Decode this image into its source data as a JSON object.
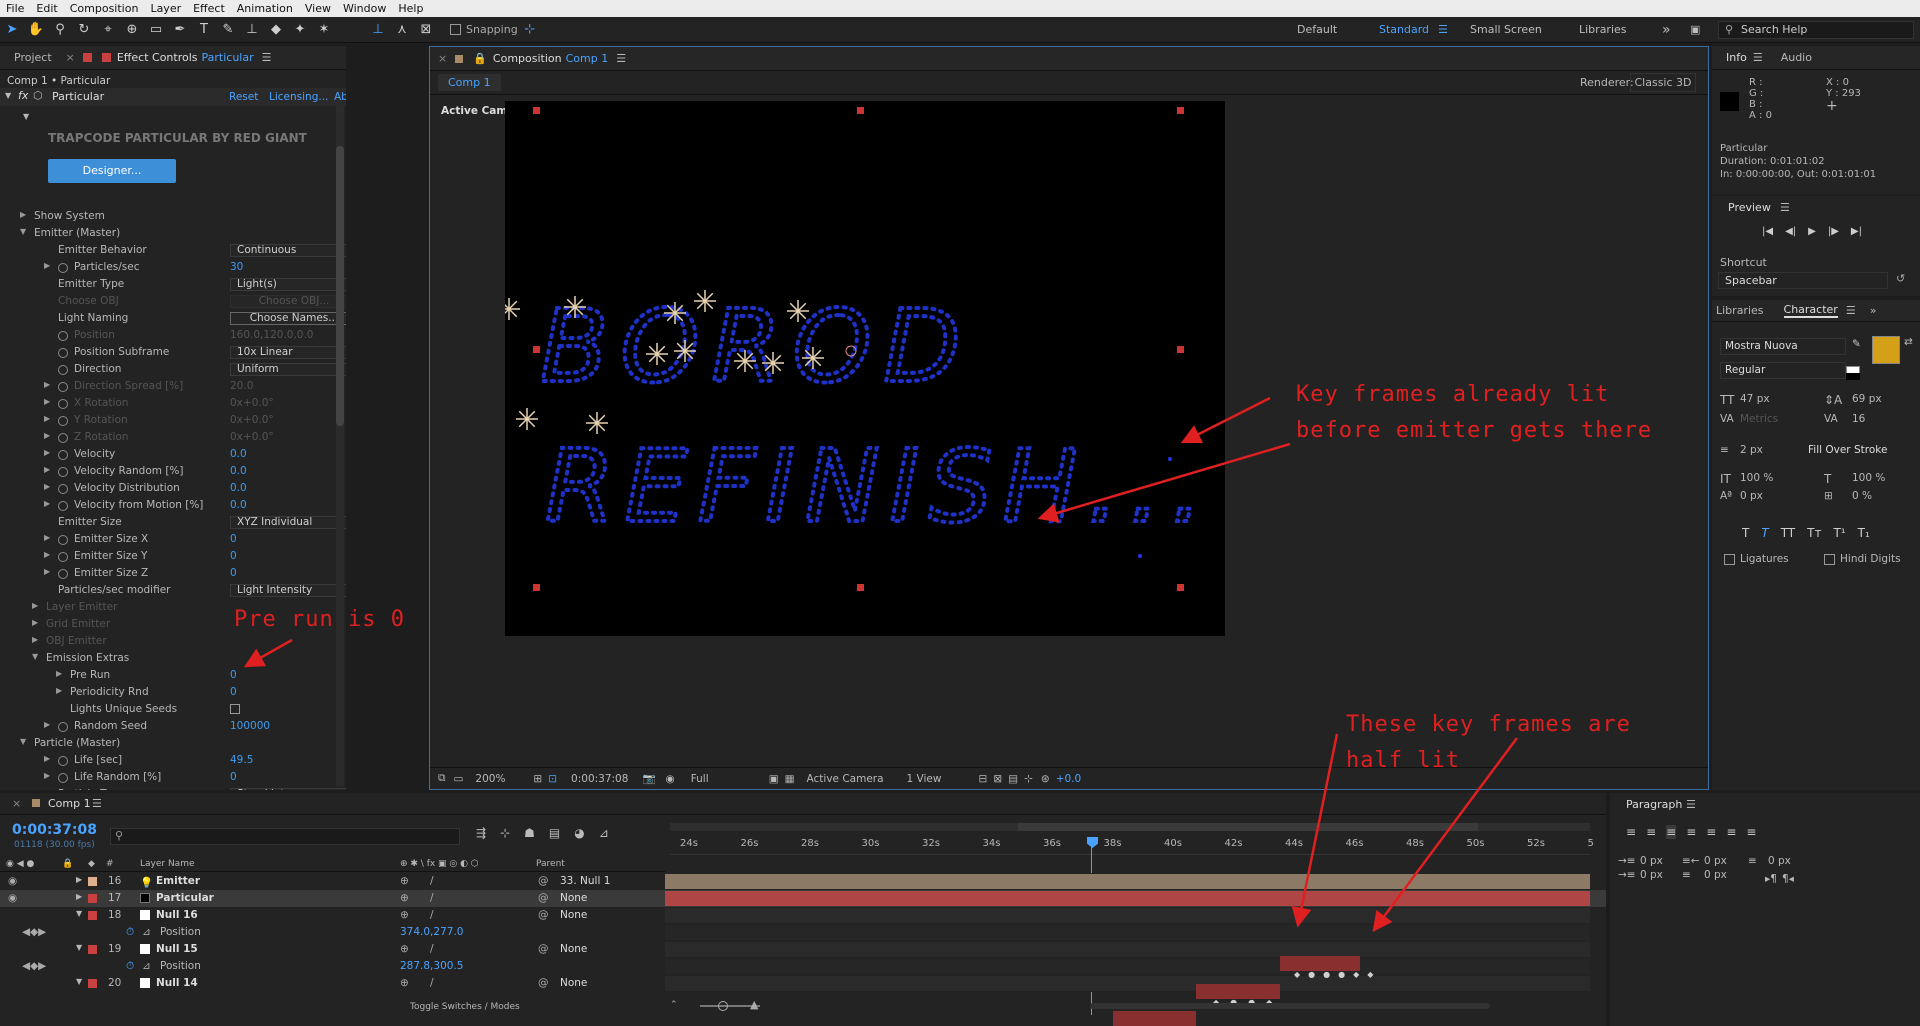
{
  "menu": [
    "File",
    "Edit",
    "Composition",
    "Layer",
    "Effect",
    "Animation",
    "View",
    "Window",
    "Help"
  ],
  "toolbar": {
    "snapping": "Snapping",
    "workspaces": [
      "Default",
      "Standard",
      "Small Screen",
      "Libraries"
    ],
    "active_workspace": "Standard",
    "search_placeholder": "Search Help",
    "more": "»"
  },
  "effect_panel": {
    "tab_project": "Project",
    "tab_effect_controls": "Effect Controls",
    "tab_effect_layer": "Particular",
    "breadcrumb": "Comp 1 • Particular",
    "effect_name": "Particular",
    "fx": "fx",
    "reset": "Reset",
    "licensing": "Licensing...",
    "about": "About...",
    "brand": "TRAPCODE PARTICULAR BY RED GIANT",
    "designer_button": "Designer...",
    "rows": [
      {
        "label": "Show System",
        "indent": 0,
        "tri": "right"
      },
      {
        "label": "Emitter (Master)",
        "indent": 0,
        "tri": "down"
      },
      {
        "label": "Emitter Behavior",
        "indent": 2,
        "dd": "Continuous"
      },
      {
        "label": "Particles/sec",
        "indent": 2,
        "tri": "right",
        "sw": true,
        "value": "30"
      },
      {
        "label": "Emitter Type",
        "indent": 2,
        "dd": "Light(s)"
      },
      {
        "label": "Choose OBJ",
        "indent": 2,
        "dim": true,
        "button": "Choose OBJ..."
      },
      {
        "label": "Light Naming",
        "indent": 2,
        "button": "Choose Names..."
      },
      {
        "label": "Position",
        "indent": 2,
        "sw": true,
        "dim": true,
        "value": "160.0,120.0,0.0"
      },
      {
        "label": "Position Subframe",
        "indent": 2,
        "sw": true,
        "dd": "10x Linear"
      },
      {
        "label": "Direction",
        "indent": 2,
        "sw": true,
        "dd": "Uniform"
      },
      {
        "label": "Direction Spread [%]",
        "indent": 2,
        "tri": "right",
        "sw": true,
        "dim": true,
        "value": "20.0"
      },
      {
        "label": "X Rotation",
        "indent": 2,
        "tri": "right",
        "sw": true,
        "dim": true,
        "value": "0x+0.0°"
      },
      {
        "label": "Y Rotation",
        "indent": 2,
        "tri": "right",
        "sw": true,
        "dim": true,
        "value": "0x+0.0°"
      },
      {
        "label": "Z Rotation",
        "indent": 2,
        "tri": "right",
        "sw": true,
        "dim": true,
        "value": "0x+0.0°"
      },
      {
        "label": "Velocity",
        "indent": 2,
        "tri": "right",
        "sw": true,
        "value": "0.0"
      },
      {
        "label": "Velocity Random [%]",
        "indent": 2,
        "tri": "right",
        "sw": true,
        "value": "0.0"
      },
      {
        "label": "Velocity Distribution",
        "indent": 2,
        "tri": "right",
        "sw": true,
        "value": "0.0"
      },
      {
        "label": "Velocity from Motion [%]",
        "indent": 2,
        "tri": "right",
        "sw": true,
        "value": "0.0"
      },
      {
        "label": "Emitter Size",
        "indent": 2,
        "dd": "XYZ Individual"
      },
      {
        "label": "Emitter Size X",
        "indent": 2,
        "tri": "right",
        "sw": true,
        "value": "0"
      },
      {
        "label": "Emitter Size Y",
        "indent": 2,
        "tri": "right",
        "sw": true,
        "value": "0"
      },
      {
        "label": "Emitter Size Z",
        "indent": 2,
        "tri": "right",
        "sw": true,
        "value": "0"
      },
      {
        "label": "Particles/sec modifier",
        "indent": 2,
        "dd": "Light Intensity"
      },
      {
        "label": "Layer Emitter",
        "indent": 1,
        "tri": "right",
        "dim": true
      },
      {
        "label": "Grid Emitter",
        "indent": 1,
        "tri": "right",
        "dim": true
      },
      {
        "label": "OBJ Emitter",
        "indent": 1,
        "tri": "right",
        "dim": true
      },
      {
        "label": "Emission Extras",
        "indent": 1,
        "tri": "down"
      },
      {
        "label": "Pre Run",
        "indent": 3,
        "tri": "right",
        "value": "0"
      },
      {
        "label": "Periodicity Rnd",
        "indent": 3,
        "tri": "right",
        "value": "0"
      },
      {
        "label": "Lights Unique Seeds",
        "indent": 3,
        "check": true
      },
      {
        "label": "Random Seed",
        "indent": 2,
        "tri": "right",
        "sw": true,
        "value": "100000"
      },
      {
        "label": "Particle (Master)",
        "indent": 0,
        "tri": "down"
      },
      {
        "label": "Life [sec]",
        "indent": 2,
        "tri": "right",
        "sw": true,
        "value": "49.5"
      },
      {
        "label": "Life Random [%]",
        "indent": 2,
        "tri": "right",
        "sw": true,
        "value": "0"
      },
      {
        "label": "Particle Type",
        "indent": 2,
        "dd": "Streaklet"
      }
    ]
  },
  "comp_panel": {
    "tab": "Composition",
    "comp_name": "Comp 1",
    "subtab": "Comp 1",
    "renderer_label": "Renderer:",
    "renderer": "Classic 3D",
    "active_camera": "Active Camera",
    "text_line1": "BOROD",
    "text_line2": "REFINISH...",
    "footer": {
      "zoom": "200%",
      "timecode": "0:00:37:08",
      "quality": "Full",
      "camera": "Active Camera",
      "view": "1 View",
      "exposure": "+0.0"
    }
  },
  "annotations": {
    "keyframes_lit": [
      "Key frames already lit",
      "before emitter gets there"
    ],
    "pre_run": "Pre run is 0",
    "half_lit": [
      "These key frames are",
      "half lit"
    ]
  },
  "info_panel": {
    "tab_info": "Info",
    "tab_audio": "Audio",
    "rgb": [
      "R :",
      "G :",
      "B :",
      "A : 0"
    ],
    "x": "X : 0",
    "y": "Y : 293",
    "layer": "Particular",
    "duration": "Duration: 0:01:01:02",
    "inout": "In: 0:00:00:00, Out: 0:01:01:01"
  },
  "preview_panel": {
    "title": "Preview",
    "shortcut_label": "Shortcut",
    "shortcut": "Spacebar"
  },
  "character_panel": {
    "tab_libraries": "Libraries",
    "tab_character": "Character",
    "font": "Mostra Nuova",
    "style": "Regular",
    "font_size": "47 px",
    "leading": "69 px",
    "kerning": "Metrics",
    "tracking": "16",
    "stroke": "2 px",
    "stroke_mode": "Fill Over Stroke",
    "vscale": "100 %",
    "hscale": "100 %",
    "baseline": "0 px",
    "tsume": "0 %",
    "ligatures": "Ligatures",
    "hindi": "Hindi Digits",
    "fill_color": "#d4a017"
  },
  "paragraph_panel": {
    "title": "Paragraph",
    "values": [
      "0 px",
      "0 px",
      "0 px",
      "0 px",
      "0 px"
    ]
  },
  "timeline": {
    "tab": "Comp 1",
    "timecode": "0:00:37:08",
    "frames": "01118 (30.00 fps)",
    "search_placeholder": "",
    "col_layer_name": "Layer Name",
    "col_parent": "Parent",
    "col_num": "#",
    "toggle": "Toggle Switches / Modes",
    "ticks": [
      "24s",
      "26s",
      "28s",
      "30s",
      "32s",
      "34s",
      "36s",
      "38s",
      "40s",
      "42s",
      "44s",
      "46s",
      "48s",
      "50s",
      "52s",
      "5"
    ],
    "layers": [
      {
        "num": "16",
        "name": "Emitter",
        "color": "#e0b08c",
        "parent": "33. Null 1",
        "selected": false,
        "type": "light"
      },
      {
        "num": "17",
        "name": "Particular",
        "color": "#c94040",
        "parent": "None",
        "selected": true,
        "type": "solid"
      },
      {
        "num": "18",
        "name": "Null 16",
        "color": "#c94040",
        "parent": "None",
        "selected": false,
        "type": "null"
      },
      {
        "num": "",
        "name": "Position",
        "color": "",
        "parent": "",
        "value": "374.0,277.0",
        "prop": true
      },
      {
        "num": "19",
        "name": "Null 15",
        "color": "#c94040",
        "parent": "None",
        "selected": false,
        "type": "null"
      },
      {
        "num": "",
        "name": "Position",
        "color": "",
        "parent": "",
        "value": "287.8,300.5",
        "prop": true
      },
      {
        "num": "20",
        "name": "Null 14",
        "color": "#c94040",
        "parent": "None",
        "selected": false,
        "type": "null"
      }
    ]
  }
}
